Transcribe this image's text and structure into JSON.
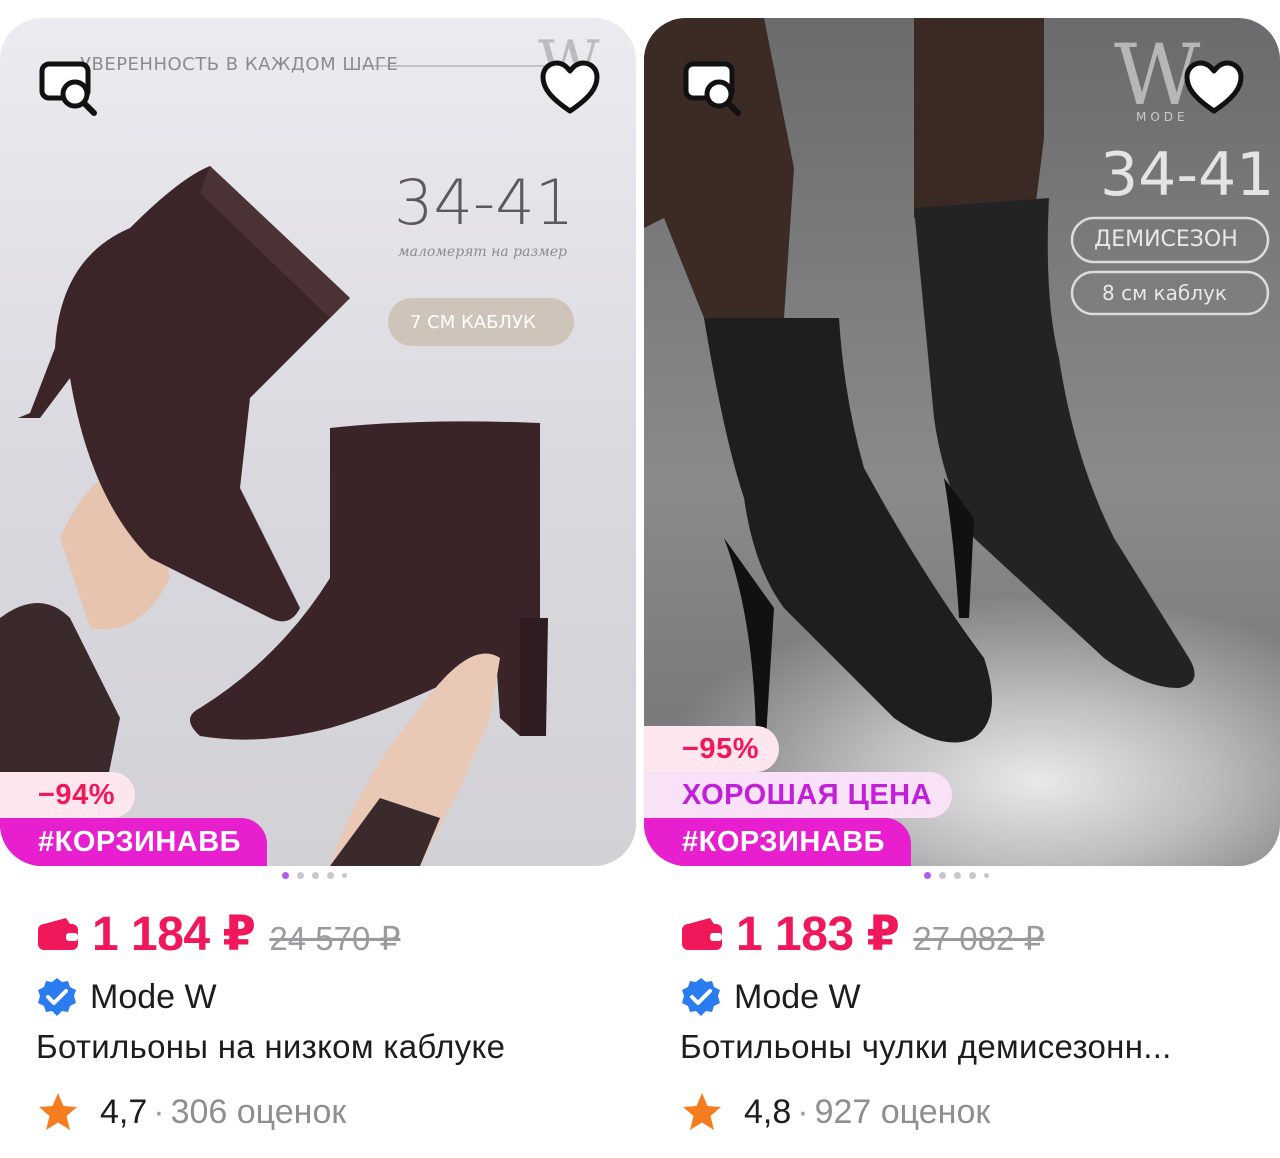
{
  "colors": {
    "price": "#f0175b",
    "tag_bg": "#e81fcf",
    "good_price": "#c21fd8",
    "discount_bg": "#fde6ee",
    "verified": "#2b7cf0",
    "star": "#f57c1f"
  },
  "icons": {
    "zoom": "image-search-icon",
    "favorite": "heart-outline-icon",
    "wallet": "wallet-icon",
    "verified": "verified-badge-icon",
    "rating": "star-icon"
  },
  "products": [
    {
      "photo": {
        "tagline": "УВЕРЕННОСТЬ В КАЖДОМ ШАГЕ",
        "size_range": "34-41",
        "size_note": "маломерят на размер",
        "heel_label": "7 СМ КАБЛУК",
        "brand_mark": "W"
      },
      "badges": {
        "discount": "−94%",
        "tag": "#КОРЗИНАВБ"
      },
      "price": "1 184 ₽",
      "old_price": "24 570 ₽",
      "seller": "Mode W",
      "title": "Ботильоны на низком каблуке",
      "rating": "4,7",
      "reviews": "306 оценок"
    },
    {
      "photo": {
        "brand_mark": "W",
        "brand_sub": "MODE",
        "size_range": "34-41",
        "season_label": "ДЕМИСЕЗОН",
        "heel_label": "8 см каблук"
      },
      "badges": {
        "discount": "−95%",
        "good_price": "ХОРОШАЯ ЦЕНА",
        "tag": "#КОРЗИНАВБ"
      },
      "price": "1 183 ₽",
      "old_price": "27 082 ₽",
      "seller": "Mode W",
      "title": "Ботильоны чулки демисезонн...",
      "rating": "4,8",
      "reviews": "927 оценок"
    }
  ]
}
